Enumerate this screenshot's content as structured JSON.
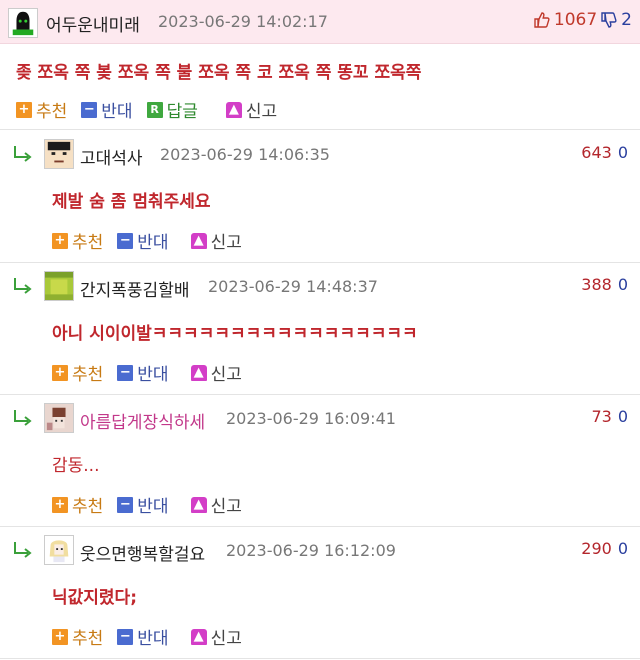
{
  "post": {
    "author": "어두운내미래",
    "date": "2023-06-29 14:02:17",
    "upvotes": "1067",
    "downvotes": "2",
    "body": "좆 쪼옥 쪽 봊 쪼옥 쪽 불 쪼옥 쪽 코 쪼옥 쪽 똥꼬 쪼옥쪽",
    "actions": {
      "recommend": "추천",
      "oppose": "반대",
      "reply": "답글",
      "report": "신고",
      "reply_icon_letter": "R"
    }
  },
  "replies": [
    {
      "author": "고대석사",
      "date": "2023-06-29 14:06:35",
      "up": "643",
      "down": "0",
      "body": "제발 숨 좀 멈춰주세요",
      "recommend": "추천",
      "oppose": "반대",
      "report": "신고"
    },
    {
      "author": "간지폭풍김할배",
      "date": "2023-06-29 14:48:37",
      "up": "388",
      "down": "0",
      "body": "아니 시이이발ㅋㅋㅋㅋㅋㅋㅋㅋㅋㅋㅋㅋㅋㅋㅋㅋㅋ",
      "recommend": "추천",
      "oppose": "반대",
      "report": "신고"
    },
    {
      "author": "아름답게장식하세",
      "date": "2023-06-29 16:09:41",
      "up": "73",
      "down": "0",
      "body": "감동...",
      "recommend": "추천",
      "oppose": "반대",
      "report": "신고"
    },
    {
      "author": "웃으면행복할걸요",
      "date": "2023-06-29 16:12:09",
      "up": "290",
      "down": "0",
      "body": "닉값지렸다;",
      "recommend": "추천",
      "oppose": "반대",
      "report": "신고"
    }
  ],
  "icons": {
    "reply_arrow": "reply-arrow-icon",
    "thumb_up": "thumb-up-icon",
    "thumb_down": "thumb-down-icon",
    "recommend": "plus-icon",
    "oppose": "minus-icon",
    "reply": "reply-r-icon",
    "report": "siren-icon"
  },
  "colors": {
    "header_bg": "#fde9ef",
    "body_red": "#c0272d",
    "recommend": "#f29423",
    "oppose": "#4a6bd0",
    "reply": "#3fa83f",
    "report": "#d33ec7"
  }
}
